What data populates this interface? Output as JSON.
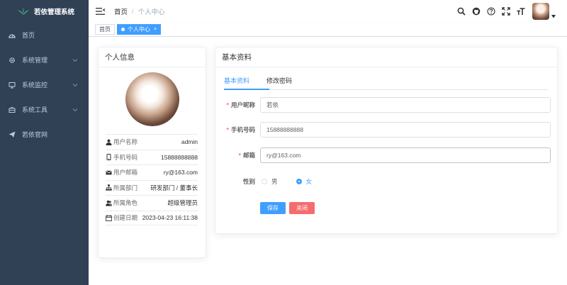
{
  "sidebar": {
    "logo_title": "若依管理系统",
    "items": [
      {
        "label": "首页",
        "icon": "dashboard-icon",
        "has_children": false
      },
      {
        "label": "系统管理",
        "icon": "gear-icon",
        "has_children": true
      },
      {
        "label": "系统监控",
        "icon": "monitor-icon",
        "has_children": true
      },
      {
        "label": "系统工具",
        "icon": "toolbox-icon",
        "has_children": true
      },
      {
        "label": "若依官网",
        "icon": "paper-plane-icon",
        "has_children": false
      }
    ]
  },
  "navbar": {
    "breadcrumb_home": "首页",
    "breadcrumb_sep": "/",
    "breadcrumb_current": "个人中心"
  },
  "tags": {
    "home": "首页",
    "current": "个人中心",
    "close": "×"
  },
  "profile": {
    "header": "个人信息",
    "rows": [
      {
        "label": "用户名称",
        "value": "admin",
        "icon": "user-icon"
      },
      {
        "label": "手机号码",
        "value": "15888888888",
        "icon": "phone-icon"
      },
      {
        "label": "用户邮箱",
        "value": "ry@163.com",
        "icon": "email-icon"
      },
      {
        "label": "所属部门",
        "value": "研发部门 / 董事长",
        "icon": "tree-icon"
      },
      {
        "label": "所属角色",
        "value": "超级管理员",
        "icon": "peoples-icon"
      },
      {
        "label": "创建日期",
        "value": "2023-04-23 16:11:38",
        "icon": "date-icon"
      }
    ]
  },
  "basic": {
    "header": "基本资料",
    "tabs": [
      "基本资料",
      "修改密码"
    ],
    "form": {
      "nickname_label": "用户昵称",
      "nickname_value": "若依",
      "phone_label": "手机号码",
      "phone_value": "15888888888",
      "email_label": "邮箱",
      "email_value": "ry@163.com",
      "gender_label": "性别",
      "gender_male": "男",
      "gender_female": "女",
      "required_mark": "*"
    },
    "save_label": "保存",
    "close_label": "关闭"
  },
  "colors": {
    "sidebar_bg": "#304156",
    "primary": "#409eff",
    "danger": "#f56c6c"
  }
}
